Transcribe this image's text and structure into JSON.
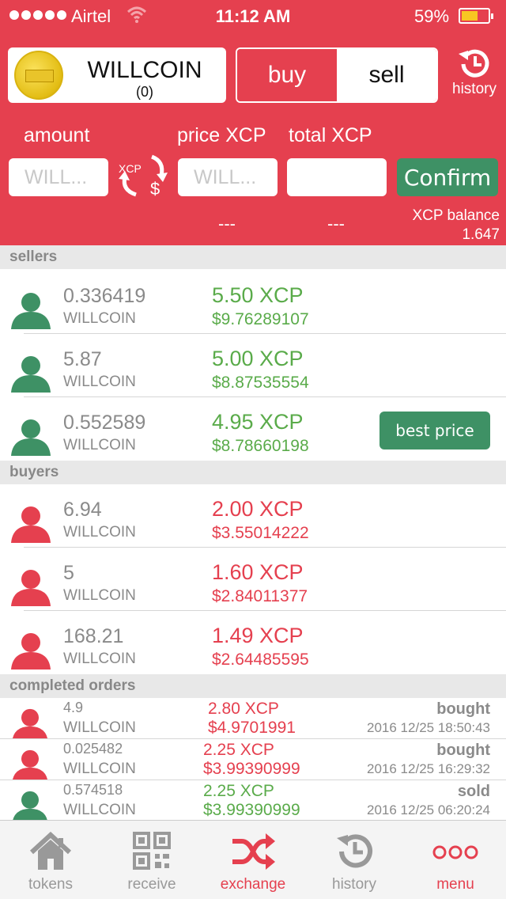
{
  "status_bar": {
    "carrier": "Airtel",
    "time": "11:12 AM",
    "battery": "59%"
  },
  "token": {
    "name": "WILLCOIN",
    "count": "(0)"
  },
  "toggle": {
    "buy": "buy",
    "sell": "sell",
    "selected": "buy"
  },
  "history_top": "history",
  "form": {
    "amount_label": "amount",
    "price_label": "price XCP",
    "total_label": "total XCP",
    "amount_placeholder": "WILL...",
    "price_placeholder": "WILL...",
    "total_value": "",
    "swap_label": "XCP",
    "swap_symbol": "$",
    "confirm": "Confirm",
    "price_dash": "---",
    "total_dash": "---",
    "balance_label": "XCP balance",
    "balance_value": "1.647"
  },
  "sections": {
    "sellers": "sellers",
    "buyers": "buyers",
    "completed": "completed orders"
  },
  "sellers": [
    {
      "qty": "0.336419",
      "unit": "WILLCOIN",
      "price": "5.50 XCP",
      "usd": "$9.76289107"
    },
    {
      "qty": "5.87",
      "unit": "WILLCOIN",
      "price": "5.00 XCP",
      "usd": "$8.87535554"
    },
    {
      "qty": "0.552589",
      "unit": "WILLCOIN",
      "price": "4.95 XCP",
      "usd": "$8.78660198",
      "badge": "best price"
    }
  ],
  "buyers": [
    {
      "qty": "6.94",
      "unit": "WILLCOIN",
      "price": "2.00 XCP",
      "usd": "$3.55014222"
    },
    {
      "qty": "5",
      "unit": "WILLCOIN",
      "price": "1.60 XCP",
      "usd": "$2.84011377"
    },
    {
      "qty": "168.21",
      "unit": "WILLCOIN",
      "price": "1.49 XCP",
      "usd": "$2.64485595"
    }
  ],
  "completed": [
    {
      "qty": "4.9",
      "unit": "WILLCOIN",
      "price": "2.80 XCP",
      "usd": "$4.9701991",
      "status": "bought",
      "date": "2016 12/25 18:50:43"
    },
    {
      "qty": "0.025482",
      "unit": "WILLCOIN",
      "price": "2.25 XCP",
      "usd": "$3.99390999",
      "status": "bought",
      "date": "2016 12/25 16:29:32"
    },
    {
      "qty": "0.574518",
      "unit": "WILLCOIN",
      "price": "2.25 XCP",
      "usd": "$3.99390999",
      "status": "sold",
      "date": "2016 12/25 06:20:24"
    }
  ],
  "tabs": [
    {
      "label": "tokens",
      "icon": "home-icon"
    },
    {
      "label": "receive",
      "icon": "qr-code-icon"
    },
    {
      "label": "exchange",
      "icon": "shuffle-icon"
    },
    {
      "label": "history",
      "icon": "history-icon"
    },
    {
      "label": "menu",
      "icon": "more-icon"
    }
  ],
  "colors": {
    "accent": "#e5404f",
    "green_button": "#3e9165",
    "seller_text": "#5aab4a",
    "seller_avatar": "#3e9165",
    "buyer_avatar": "#e5404f"
  }
}
